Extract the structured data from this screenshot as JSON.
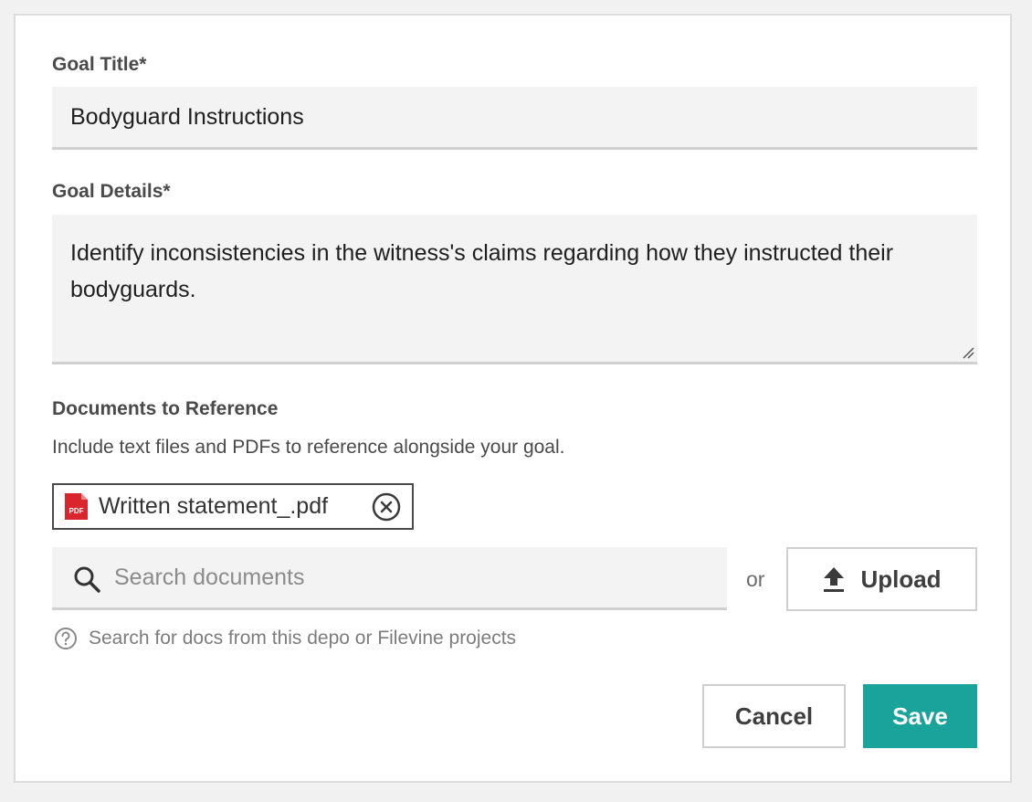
{
  "goal_title": {
    "label": "Goal Title*",
    "value": "Bodyguard Instructions"
  },
  "goal_details": {
    "label": "Goal Details*",
    "value": "Identify inconsistencies in the witness's claims regarding how they instructed their bodyguards."
  },
  "documents": {
    "label": "Documents to Reference",
    "helper": "Include text files and PDFs to reference alongside your goal.",
    "attachments": [
      {
        "name": "Written statement_.pdf",
        "icon": "pdf-icon",
        "icon_text": "PDF"
      }
    ],
    "search": {
      "placeholder": "Search documents",
      "value": ""
    },
    "or_text": "or",
    "upload_label": "Upload",
    "hint": "Search for docs from this depo or Filevine projects"
  },
  "actions": {
    "cancel_label": "Cancel",
    "save_label": "Save"
  },
  "colors": {
    "accent": "#1aa39a",
    "pdf_red": "#d9262c",
    "field_bg": "#f3f3f3"
  }
}
